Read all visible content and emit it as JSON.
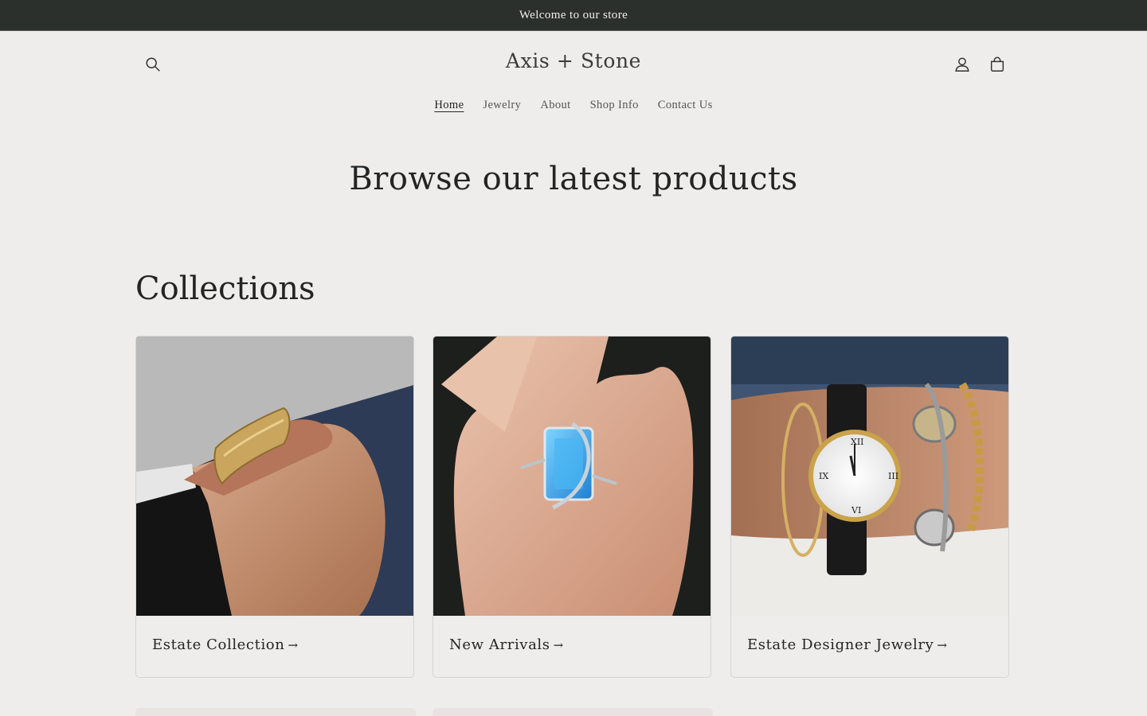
{
  "announcement": {
    "text": "Welcome to our store"
  },
  "header": {
    "logo": "Axis + Stone",
    "icons": {
      "search": "search-icon",
      "account": "account-icon",
      "cart": "cart-icon"
    }
  },
  "nav": {
    "items": [
      {
        "label": "Home",
        "active": true
      },
      {
        "label": "Jewelry",
        "active": false
      },
      {
        "label": "About",
        "active": false
      },
      {
        "label": "Shop Info",
        "active": false
      },
      {
        "label": "Contact Us",
        "active": false
      }
    ]
  },
  "hero": {
    "title": "Browse our latest products"
  },
  "collections": {
    "title": "Collections",
    "cards": [
      {
        "label": "Estate Collection",
        "arrow": "→",
        "image": "gold bangle bracelet on wrist"
      },
      {
        "label": "New Arrivals",
        "arrow": "→",
        "image": "blue topaz ring on hand"
      },
      {
        "label": "Estate Designer Jewelry",
        "arrow": "→",
        "image": "gold watch and bracelets on wrist"
      }
    ]
  },
  "colors": {
    "announcement_bg": "#2b302d",
    "page_bg": "#eeedec",
    "text": "#242424"
  }
}
